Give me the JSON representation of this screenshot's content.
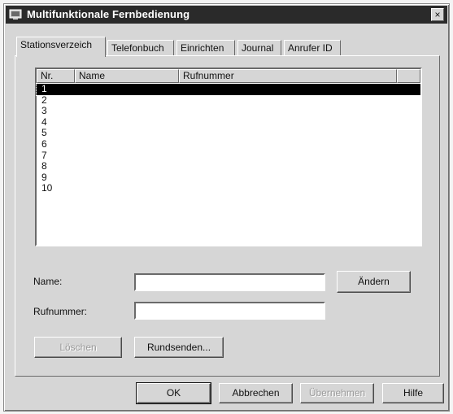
{
  "window": {
    "title": "Multifunktionale Fernbedienung",
    "close_label": "×"
  },
  "tabs": [
    {
      "label": "Stationsverzeich",
      "active": true
    },
    {
      "label": "Telefonbuch",
      "active": false
    },
    {
      "label": "Einrichten",
      "active": false
    },
    {
      "label": "Journal",
      "active": false
    },
    {
      "label": "Anrufer ID",
      "active": false
    }
  ],
  "list": {
    "columns": [
      "Nr.",
      "Name",
      "Rufnummer"
    ],
    "rows": [
      "1",
      "2",
      "3",
      "4",
      "5",
      "6",
      "7",
      "8",
      "9",
      "10"
    ],
    "selected_row": "1"
  },
  "form": {
    "name_label": "Name:",
    "name_value": "",
    "rufnummer_label": "Rufnummer:",
    "rufnummer_value": "",
    "aendern_label": "Ändern"
  },
  "actions": {
    "loeschen_label": "Löschen",
    "rundsenden_label": "Rundsenden..."
  },
  "footer": {
    "ok_label": "OK",
    "abbrechen_label": "Abbrechen",
    "uebernehmen_label": "Übernehmen",
    "hilfe_label": "Hilfe"
  }
}
